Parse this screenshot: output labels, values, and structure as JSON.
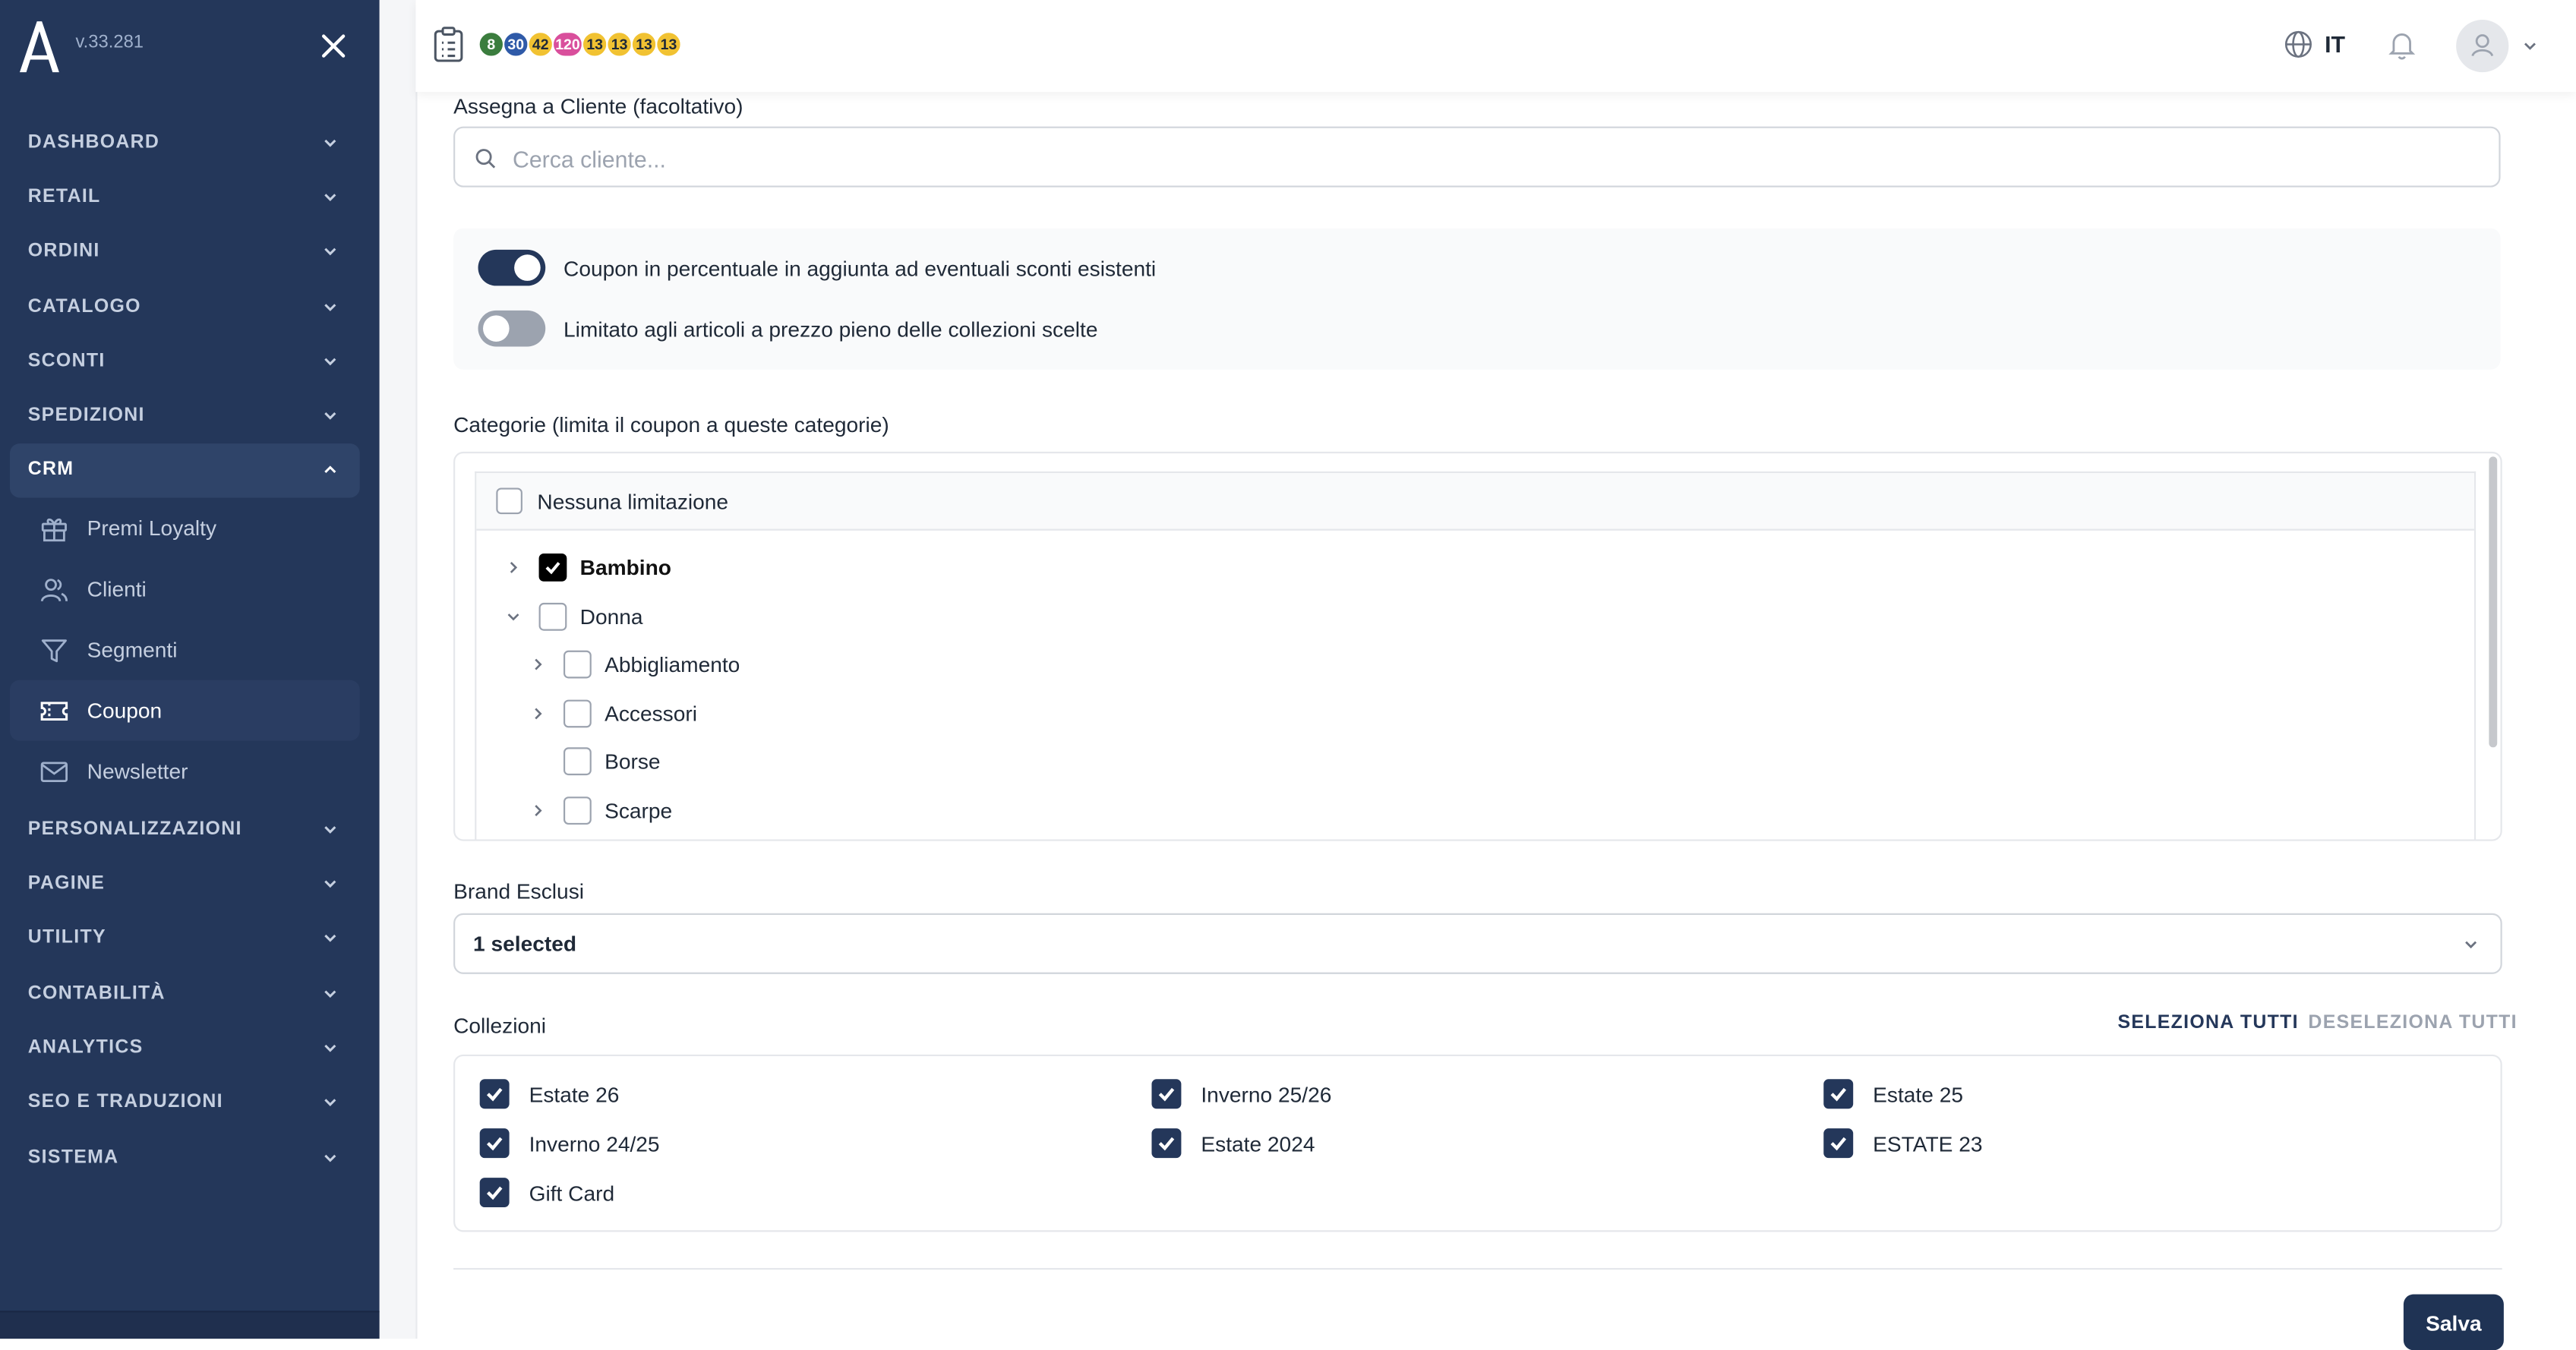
{
  "app": {
    "version": "v.33.281"
  },
  "sidebar": {
    "items": [
      {
        "label": "DASHBOARD"
      },
      {
        "label": "RETAIL"
      },
      {
        "label": "ORDINI"
      },
      {
        "label": "CATALOGO"
      },
      {
        "label": "SCONTI"
      },
      {
        "label": "SPEDIZIONI"
      },
      {
        "label": "CRM",
        "open": true
      },
      {
        "label": "PERSONALIZZAZIONI"
      },
      {
        "label": "PAGINE"
      },
      {
        "label": "UTILITY"
      },
      {
        "label": "CONTABILITÀ"
      },
      {
        "label": "ANALYTICS"
      },
      {
        "label": "SEO E TRADUZIONI"
      },
      {
        "label": "SISTEMA"
      }
    ],
    "crm_subitems": [
      {
        "label": "Premi Loyalty",
        "icon": "gift-icon"
      },
      {
        "label": "Clienti",
        "icon": "users-icon"
      },
      {
        "label": "Segmenti",
        "icon": "filter-icon"
      },
      {
        "label": "Coupon",
        "icon": "ticket-icon",
        "active": true
      },
      {
        "label": "Newsletter",
        "icon": "mail-icon"
      }
    ]
  },
  "topbar": {
    "badges": [
      {
        "value": "8",
        "bg": "#3b7d3e",
        "fg": "#ffffff"
      },
      {
        "value": "30",
        "bg": "#2f5aa8",
        "fg": "#ffffff"
      },
      {
        "value": "42",
        "bg": "#f1c232",
        "fg": "#1f2937"
      },
      {
        "value": "120",
        "bg": "#d94f9c",
        "fg": "#ffffff"
      },
      {
        "value": "13",
        "bg": "#f1c232",
        "fg": "#1f2937"
      },
      {
        "value": "13",
        "bg": "#f1c232",
        "fg": "#1f2937"
      },
      {
        "value": "13",
        "bg": "#f1c232",
        "fg": "#1f2937"
      },
      {
        "value": "13",
        "bg": "#f1c232",
        "fg": "#1f2937"
      }
    ],
    "language": "IT"
  },
  "form": {
    "client_label": "Assegna a Cliente (facoltativo)",
    "client_search_placeholder": "Cerca cliente...",
    "client_search_value": "",
    "toggle_percent_label": "Coupon in percentuale in aggiunta ad eventuali sconti esistenti",
    "toggle_percent_on": true,
    "toggle_fullprice_label": "Limitato agli articoli a prezzo pieno delle collezioni scelte",
    "toggle_fullprice_on": false,
    "categories_label": "Categorie (limita il coupon a queste categorie)",
    "no_limit_label": "Nessuna limitazione",
    "categories": {
      "bambino": {
        "label": "Bambino",
        "checked": true
      },
      "donna": {
        "label": "Donna",
        "checked": false,
        "expanded": true
      },
      "abbigliamento": {
        "label": "Abbigliamento",
        "checked": false
      },
      "accessori": {
        "label": "Accessori",
        "checked": false
      },
      "borse": {
        "label": "Borse",
        "checked": false
      },
      "scarpe": {
        "label": "Scarpe",
        "checked": false
      }
    },
    "brand_label": "Brand Esclusi",
    "brand_value": "1 selected",
    "collections_label": "Collezioni",
    "select_all": "SELEZIONA TUTTI",
    "deselect_all": "DESELEZIONA TUTTI",
    "collections": [
      {
        "label": "Estate 26",
        "checked": true
      },
      {
        "label": "Inverno 25/26",
        "checked": true
      },
      {
        "label": "Estate 25",
        "checked": true
      },
      {
        "label": "Inverno 24/25",
        "checked": true
      },
      {
        "label": "Estate 2024",
        "checked": true
      },
      {
        "label": "ESTATE 23",
        "checked": true
      },
      {
        "label": "Gift Card",
        "checked": true
      }
    ],
    "save_label": "Salva"
  },
  "colors": {
    "sidebar_bg": "#24375a",
    "accent": "#24375a",
    "save_button": "#1f3354"
  }
}
